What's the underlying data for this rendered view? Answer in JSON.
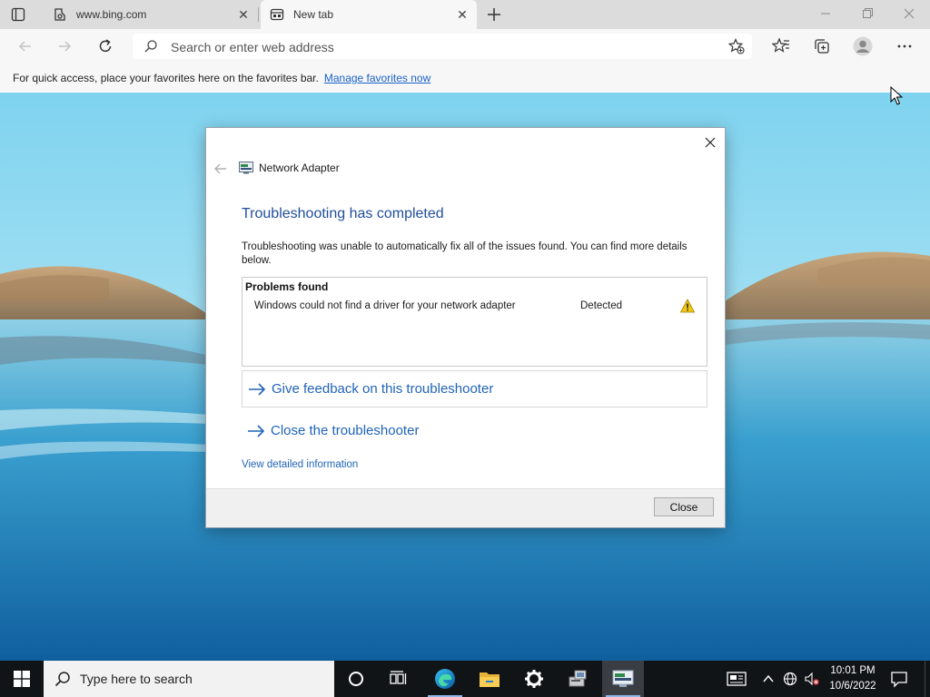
{
  "browser": {
    "tabs": [
      {
        "label": "www.bing.com",
        "icon": "bing-icon"
      },
      {
        "label": "New tab",
        "icon": "newtab-icon"
      }
    ],
    "address_placeholder": "Search or enter web address",
    "favorites_bar": {
      "text": "For quick access, place your favorites here on the favorites bar.",
      "link": "Manage favorites now"
    }
  },
  "dialog": {
    "app_name": "Network Adapter",
    "heading": "Troubleshooting has completed",
    "description": "Troubleshooting was unable to automatically fix all of the issues found. You can find more details below.",
    "problems_header": "Problems found",
    "problems": [
      {
        "name": "Windows could not find a driver for your network adapter",
        "status": "Detected",
        "icon": "warning-icon"
      }
    ],
    "feedback_link": "Give feedback on this troubleshooter",
    "close_link": "Close the troubleshooter",
    "details_link": "View detailed information",
    "close_button": "Close"
  },
  "taskbar": {
    "search_placeholder": "Type here to search",
    "time": "10:01 PM",
    "date": "10/6/2022"
  },
  "colors": {
    "link": "#1f63b8",
    "heading": "#1f4e9c",
    "taskbar": "#111417",
    "accent": "#0078d4"
  }
}
